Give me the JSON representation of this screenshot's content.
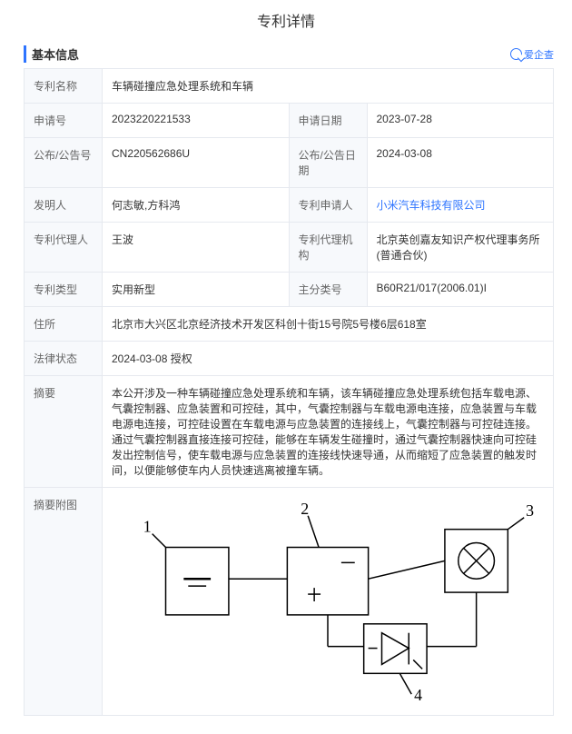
{
  "page_title": "专利详情",
  "section_title": "基本信息",
  "brand": "爱企查",
  "rows": {
    "name_label": "专利名称",
    "name_value": "车辆碰撞应急处理系统和车辆",
    "app_no_label": "申请号",
    "app_no_value": "2023220221533",
    "app_date_label": "申请日期",
    "app_date_value": "2023-07-28",
    "pub_no_label": "公布/公告号",
    "pub_no_value": "CN220562686U",
    "pub_date_label": "公布/公告日期",
    "pub_date_value": "2024-03-08",
    "inventor_label": "发明人",
    "inventor_value": "何志敏,方科鸿",
    "applicant_label": "专利申请人",
    "applicant_value": "小米汽车科技有限公司",
    "agent_label": "专利代理人",
    "agent_value": "王波",
    "agency_label": "专利代理机构",
    "agency_value": "北京英创嘉友知识产权代理事务所(普通合伙)",
    "type_label": "专利类型",
    "type_value": "实用新型",
    "class_label": "主分类号",
    "class_value": "B60R21/017(2006.01)I",
    "addr_label": "住所",
    "addr_value": "北京市大兴区北京经济技术开发区科创十街15号院5号楼6层618室",
    "legal_label": "法律状态",
    "legal_value": "2024-03-08 授权",
    "abstract_label": "摘要",
    "abstract_value": "本公开涉及一种车辆碰撞应急处理系统和车辆，该车辆碰撞应急处理系统包括车载电源、气囊控制器、应急装置和可控硅，其中，气囊控制器与车载电源电连接，应急装置与车载电源电连接，可控硅设置在车载电源与应急装置的连接线上，气囊控制器与可控硅连接。通过气囊控制器直接连接可控硅，能够在车辆发生碰撞时，通过气囊控制器快速向可控硅发出控制信号，使车载电源与应急装置的连接线快速导通，从而缩短了应急装置的触发时间，以便能够使车内人员快速逃离被撞车辆。",
    "figure_label": "摘要附图",
    "fig_labels": {
      "n1": "1",
      "n2": "2",
      "n3": "3",
      "n4": "4"
    }
  }
}
